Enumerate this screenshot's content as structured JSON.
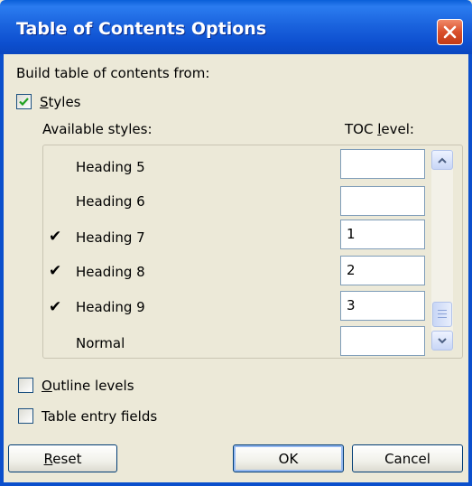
{
  "window": {
    "title": "Table of Contents Options"
  },
  "build_from_label": "Build table of contents from:",
  "styles_option": {
    "label": "Styles",
    "checked": true
  },
  "columns": {
    "available": "Available styles:",
    "toc_level": "TOC level:"
  },
  "styles": [
    {
      "name": "Heading 5",
      "checked": false,
      "level": ""
    },
    {
      "name": "Heading 6",
      "checked": false,
      "level": ""
    },
    {
      "name": "Heading 7",
      "checked": true,
      "level": "1"
    },
    {
      "name": "Heading 8",
      "checked": true,
      "level": "2"
    },
    {
      "name": "Heading 9",
      "checked": true,
      "level": "3"
    },
    {
      "name": "Normal",
      "checked": false,
      "level": ""
    }
  ],
  "check_glyph": "✔",
  "outline_levels": {
    "label": "Outline levels",
    "checked": false
  },
  "table_entry_fields": {
    "label": "Table entry fields",
    "checked": false
  },
  "buttons": {
    "reset": "Reset",
    "ok": "OK",
    "cancel": "Cancel"
  }
}
